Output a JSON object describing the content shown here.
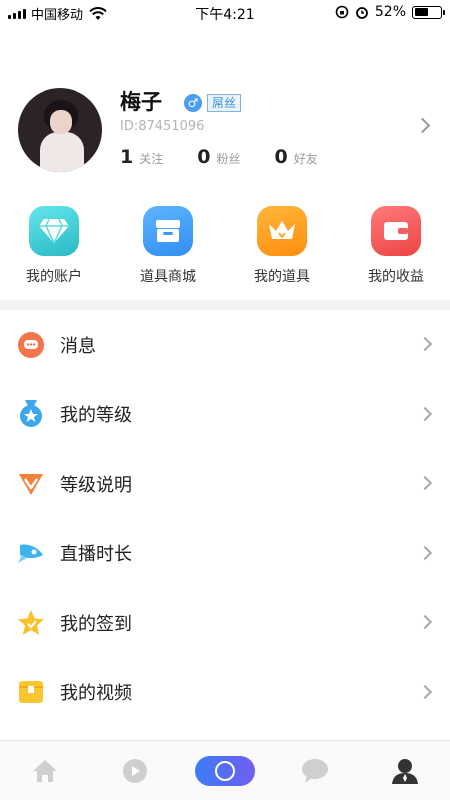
{
  "status_bar": {
    "carrier": "中国移动",
    "time": "下午4:21",
    "battery": "52%",
    "battery_level": 0.52
  },
  "profile": {
    "nickname": "梅子",
    "gender_symbol": "♂",
    "fan_tag": "屌丝",
    "id": "ID:87451096",
    "stats": [
      {
        "num": "1",
        "label": "关注"
      },
      {
        "num": "0",
        "label": "粉丝"
      },
      {
        "num": "0",
        "label": "好友"
      }
    ]
  },
  "quick_actions": [
    {
      "label": "我的账户",
      "icon": "diamond-icon"
    },
    {
      "label": "道具商城",
      "icon": "store-icon"
    },
    {
      "label": "我的道具",
      "icon": "crown-icon"
    },
    {
      "label": "我的收益",
      "icon": "wallet-icon"
    }
  ],
  "menu": [
    {
      "label": "消息",
      "icon": "message-icon",
      "color": "#f2754c"
    },
    {
      "label": "我的等级",
      "icon": "medal-icon",
      "color": "#3ea6ec"
    },
    {
      "label": "等级说明",
      "icon": "badge-icon",
      "color": "#f4803a"
    },
    {
      "label": "直播时长",
      "icon": "rocket-icon",
      "color": "#3fb3ee"
    },
    {
      "label": "我的签到",
      "icon": "star-icon",
      "color": "#f7c22b"
    },
    {
      "label": "我的视频",
      "icon": "box-icon",
      "color": "#f9c532"
    }
  ],
  "tabbar": [
    "home-icon",
    "video-icon",
    "live-button",
    "chat-icon",
    "profile-icon"
  ]
}
